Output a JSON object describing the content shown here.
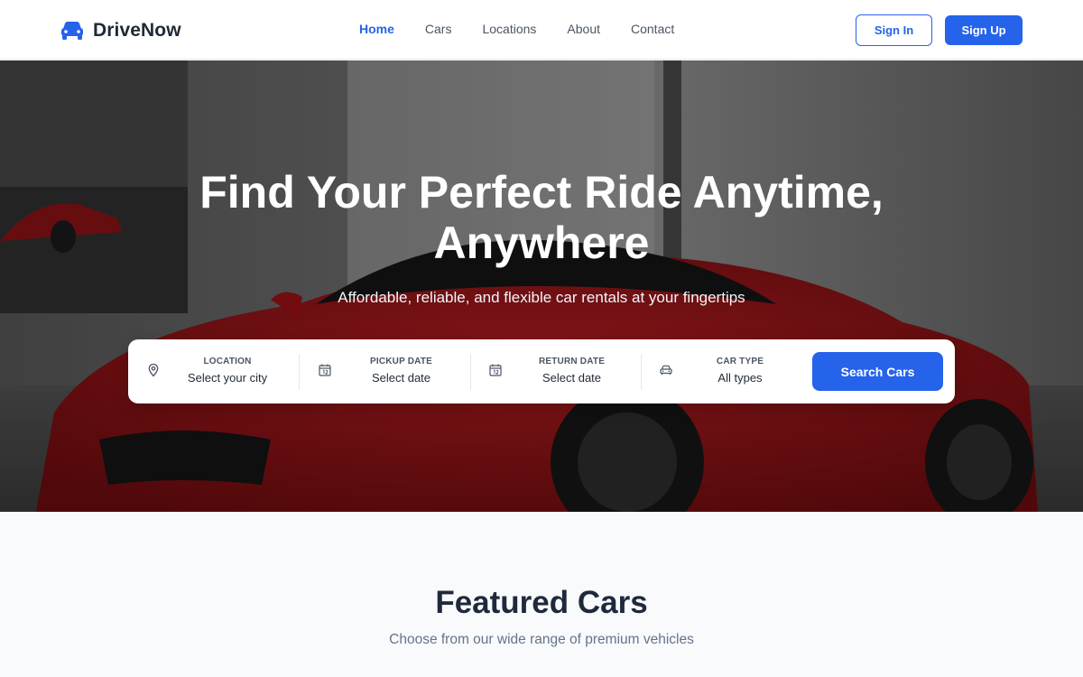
{
  "brand": {
    "name": "DriveNow",
    "accent": "#2563eb"
  },
  "nav": [
    {
      "label": "Home",
      "active": true
    },
    {
      "label": "Cars",
      "active": false
    },
    {
      "label": "Locations",
      "active": false
    },
    {
      "label": "About",
      "active": false
    },
    {
      "label": "Contact",
      "active": false
    }
  ],
  "auth": {
    "sign_in": "Sign In",
    "sign_up": "Sign Up"
  },
  "hero": {
    "title_line1": "Find Your Perfect Ride Anytime,",
    "title_line2": "Anywhere",
    "subtitle": "Affordable, reliable, and flexible car rentals at your fingertips"
  },
  "search": {
    "fields": [
      {
        "label": "LOCATION",
        "value": "Select your city",
        "icon": "location-pin-icon"
      },
      {
        "label": "PICKUP DATE",
        "value": "Select date",
        "icon": "calendar-icon"
      },
      {
        "label": "RETURN DATE",
        "value": "Select date",
        "icon": "calendar-icon"
      },
      {
        "label": "CAR TYPE",
        "value": "All types",
        "icon": "car-icon"
      }
    ],
    "button": "Search Cars"
  },
  "featured": {
    "title": "Featured Cars",
    "subtitle": "Choose from our wide range of premium vehicles"
  }
}
